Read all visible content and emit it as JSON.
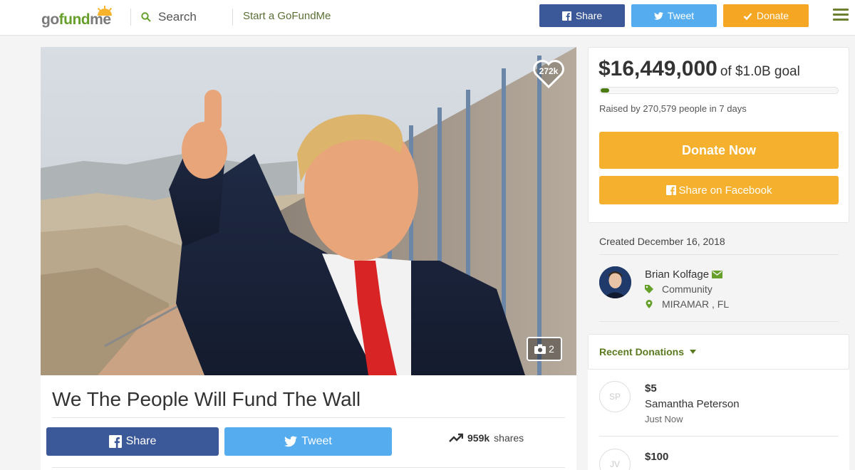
{
  "header": {
    "logo": "gofundme",
    "search_label": "Search",
    "start_label": "Start a GoFundMe",
    "share_label": "Share",
    "tweet_label": "Tweet",
    "donate_label": "Donate"
  },
  "hero": {
    "hearts": "272k",
    "photo_count": "2"
  },
  "campaign": {
    "title": "We The People Will Fund The Wall",
    "share_label": "Share",
    "tweet_label": "Tweet",
    "shares_count": "959k",
    "shares_suffix": "shares"
  },
  "panel": {
    "raised": "$16,449,000",
    "goal": "of $1.0B goal",
    "progress_fraction": 0.0164,
    "byline": "Raised by 270,579 people in 7 days",
    "donate_now": "Donate Now",
    "share_facebook": "Share on Facebook",
    "created": "Created December 16, 2018",
    "organizer": {
      "name": "Brian Kolfage",
      "category": "Community",
      "location": "MIRAMAR , FL"
    },
    "recent_donations_label": "Recent Donations"
  },
  "donations": [
    {
      "initials": "SP",
      "amount": "$5",
      "name": "Samantha Peterson",
      "time": "Just Now"
    },
    {
      "initials": "JV",
      "amount": "$100",
      "name": "",
      "time": ""
    }
  ],
  "colors": {
    "brand_green": "#66a02b",
    "facebook": "#3b5998",
    "twitter": "#55acee",
    "donate_orange": "#f5a623",
    "cta_yellow": "#f5b12d"
  }
}
